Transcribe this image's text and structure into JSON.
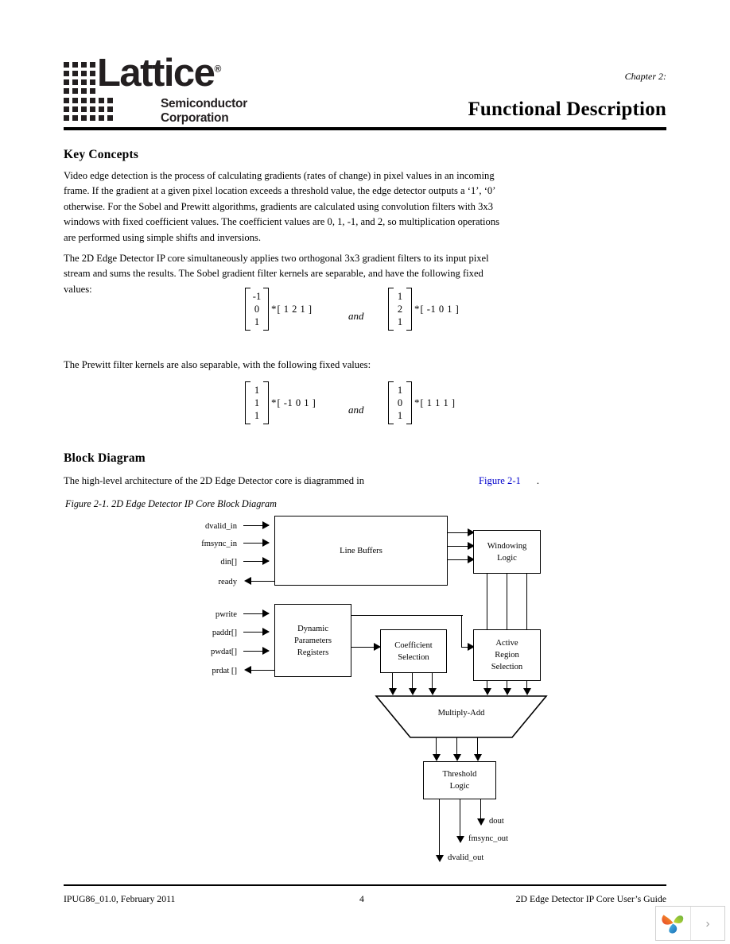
{
  "header": {
    "logo_wordmark": "Lattice",
    "logo_registered": "®",
    "logo_sub1": "Semiconductor",
    "logo_sub2": "Corporation",
    "chapter_label": "Chapter 2:",
    "chapter_title": "Functional Description"
  },
  "sections": {
    "key_concepts_heading": "Key Concepts",
    "para1": "Video edge detection is the process of calculating gradients (rates of change) in pixel values in an incoming frame. If the gradient at a given pixel location exceeds a threshold value, the edge detector outputs a ‘1’, ‘0’ otherwise. For the Sobel and Prewitt algorithms, gradients are calculated using convolution filters with 3x3 windows with fixed coefficient values. The coefficient values are 0, 1, -1, and 2, so multiplication operations are performed using simple shifts and inversions.",
    "para2": "The 2D Edge Detector IP core simultaneously applies two orthogonal 3x3 gradient filters to its input pixel stream and sums the results. The Sobel gradient filter kernels are separable, and have the following fixed values:",
    "para3": "The Prewitt filter kernels are also separable, with the following fixed values:",
    "block_diagram_heading": "Block Diagram",
    "para4_before": "The high-level architecture of the 2D Edge Detector core is diagrammed in",
    "para4_link": "Figure 2-1",
    "para4_after": ".",
    "figure_caption": "Figure 2-1. 2D Edge Detector IP Core Block Diagram"
  },
  "equations": {
    "and_word": "and",
    "star": "*",
    "sobel": {
      "left_col": [
        "-1",
        "0",
        "1"
      ],
      "left_row": "[ 1  2  1 ]",
      "right_col": [
        "1",
        "2",
        "1"
      ],
      "right_row": "[ -1   0   1 ]"
    },
    "prewitt": {
      "left_col": [
        "1",
        "1",
        "1"
      ],
      "left_row": "[ -1  0  1 ]",
      "right_col": [
        "1",
        "0",
        "1"
      ],
      "right_row": "[ 1  1  1 ]"
    }
  },
  "diagram": {
    "inputs_top": [
      "dvalid_in",
      "fmsync_in",
      "din[]",
      "ready"
    ],
    "inputs_bottom": [
      "pwrite",
      "paddr[]",
      "pwdat[]",
      "prdat []"
    ],
    "blocks": {
      "line_buffers": "Line Buffers",
      "windowing_logic_l1": "Windowing",
      "windowing_logic_l2": "Logic",
      "dynamic_params_l1": "Dynamic",
      "dynamic_params_l2": "Parameters",
      "dynamic_params_l3": "Registers",
      "coefficient_selection_l1": "Coefficient",
      "coefficient_selection_l2": "Selection",
      "active_region_l1": "Active",
      "active_region_l2": "Region",
      "active_region_l3": "Selection",
      "multiply_add": "Multiply-Add",
      "threshold_logic_l1": "Threshold",
      "threshold_logic_l2": "Logic"
    },
    "outputs": [
      "dout",
      "fmsync_out",
      "dvalid_out"
    ]
  },
  "footer": {
    "left": "IPUG86_01.0, February 2011",
    "page": "4",
    "right": "2D Edge Detector IP Core User’s Guide"
  },
  "widget": {
    "next_glyph": "›"
  },
  "colors": {
    "link": "#0000cc",
    "logo": "#231f20",
    "widget_orange": "#ee7623",
    "widget_green": "#8dc63f",
    "widget_blue": "#2e9fd8"
  }
}
